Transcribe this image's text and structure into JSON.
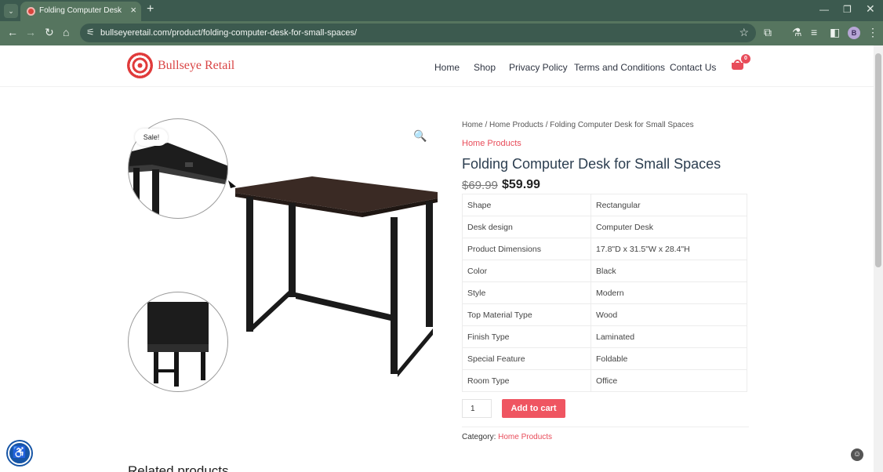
{
  "browser": {
    "tab_title": "Folding Computer Desk for Small Spaces – Bullseye Retail",
    "url": "bullseyeretail.com/product/folding-computer-desk-for-small-spaces/",
    "profile_initial": "B",
    "theme_color": "#56755f"
  },
  "header": {
    "brand": "Bullseye Retail",
    "nav": [
      "Home",
      "Shop",
      "Privacy Policy",
      "Terms and Conditions",
      "Contact Us"
    ],
    "cart_count": "0",
    "accent_color": "#e84c5a"
  },
  "product": {
    "breadcrumb": "Home / Home Products / Folding Computer Desk for Small Spaces",
    "category_link": "Home Products",
    "title": "Folding Computer Desk for Small Spaces",
    "old_price": "$69.99",
    "price": "$59.99",
    "sale_badge": "Sale!",
    "specs": [
      {
        "k": "Shape",
        "v": "Rectangular"
      },
      {
        "k": "Desk design",
        "v": "Computer Desk"
      },
      {
        "k": "Product Dimensions",
        "v": "17.8\"D x 31.5\"W x 28.4\"H"
      },
      {
        "k": "Color",
        "v": "Black"
      },
      {
        "k": "Style",
        "v": "Modern"
      },
      {
        "k": "Top Material Type",
        "v": "Wood"
      },
      {
        "k": "Finish Type",
        "v": "Laminated"
      },
      {
        "k": "Special Feature",
        "v": "Foldable"
      },
      {
        "k": "Room Type",
        "v": "Office"
      }
    ],
    "quantity": "1",
    "add_to_cart": "Add to cart",
    "category_label": "Category:",
    "category_value": "Home Products"
  },
  "related_heading": "Related products",
  "icons": {
    "zoom": "magnifier-icon",
    "cart": "shopping-basket-icon",
    "accessibility": "accessibility-icon"
  }
}
